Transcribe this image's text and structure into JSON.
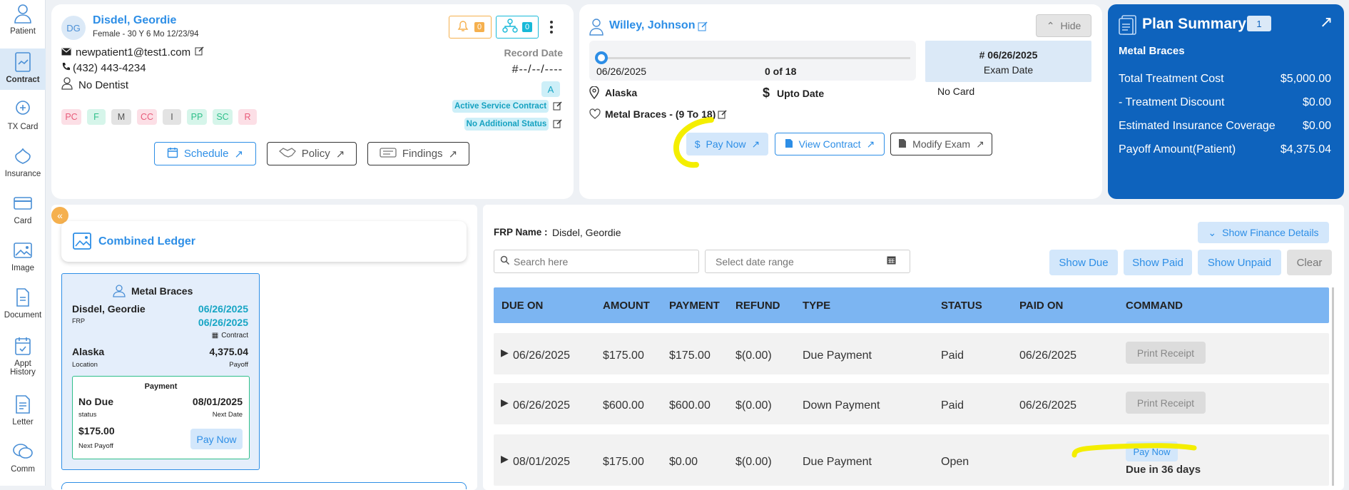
{
  "sidebar": {
    "items": [
      {
        "label": "Patient",
        "icon": "patient-icon"
      },
      {
        "label": "Contract",
        "icon": "contract-icon"
      },
      {
        "label": "TX Card",
        "icon": "tx-card-icon"
      },
      {
        "label": "Insurance",
        "icon": "insurance-icon"
      },
      {
        "label": "Card",
        "icon": "card-icon"
      },
      {
        "label": "Image",
        "icon": "image-icon"
      },
      {
        "label": "Document",
        "icon": "document-icon"
      },
      {
        "label": "Appt",
        "label2": "History",
        "icon": "appt-history-icon"
      },
      {
        "label": "Letter",
        "icon": "letter-icon"
      },
      {
        "label": "Comm",
        "icon": "comm-icon"
      }
    ]
  },
  "patient": {
    "initials": "DG",
    "name": "Disdel, Geordie",
    "details": "Female - 30 Y 6 Mo 12/23/94",
    "email": "newpatient1@test1.com",
    "phone": "(432) 443-4234",
    "dentist": "No Dentist",
    "alert_count": "0",
    "tree_count": "0",
    "record_date_label": "Record Date",
    "record_date_value": "#--/--/----",
    "badge_a": "A",
    "active_contract": "Active Service Contract",
    "no_additional_status": "No Additional Status",
    "tags": [
      "PC",
      "F",
      "M",
      "CC",
      "I",
      "PP",
      "SC",
      "R"
    ],
    "buttons": {
      "schedule": "Schedule",
      "policy": "Policy",
      "findings": "Findings"
    }
  },
  "doctor": {
    "name": "Willey, Johnson",
    "hide_label": "Hide",
    "progress_date": "06/26/2025",
    "progress_count": "0 of 18",
    "progress_fraction": 0,
    "exam_date_value": "# 06/26/2025",
    "exam_date_label": "Exam Date",
    "location": "Alaska",
    "upto_date": "Upto Date",
    "no_card": "No Card",
    "treatment": "Metal Braces - (9 To 18)",
    "buttons": {
      "pay_now": "Pay Now",
      "view_contract": "View Contract",
      "modify_exam": "Modify Exam"
    }
  },
  "plan_summary": {
    "title": "Plan Summary",
    "count": "1",
    "subtitle": "Metal Braces",
    "rows": [
      {
        "label": "Total Treatment Cost",
        "value": "$5,000.00"
      },
      {
        "label": "- Treatment Discount",
        "value": "$0.00"
      },
      {
        "label": "Estimated Insurance Coverage",
        "value": "$0.00"
      },
      {
        "label": "Payoff Amount(Patient)",
        "value": "$4,375.04"
      }
    ]
  },
  "ledger": {
    "title": "Combined Ledger",
    "contract_card": {
      "title": "Metal Braces",
      "name": "Disdel, Geordie",
      "name_sub": "FRP",
      "date1": "06/26/2025",
      "date2": "06/26/2025",
      "contract_label": "Contract",
      "location": "Alaska",
      "location_sub": "Location",
      "payoff_value": "4,375.04",
      "payoff_label": "Payoff",
      "payment": {
        "title": "Payment",
        "status": "No Due",
        "status_sub": "status",
        "next_date": "08/01/2025",
        "next_date_sub": "Next Date",
        "amount": "$175.00",
        "amount_sub": "Next Payoff",
        "pay_now": "Pay Now"
      }
    }
  },
  "finance": {
    "frp_label": "FRP Name :",
    "frp_name": "Disdel, Geordie",
    "show_finance_details": "Show Finance Details",
    "search_placeholder": "Search here",
    "date_placeholder": "Select date range",
    "filters": {
      "show_due": "Show Due",
      "show_paid": "Show Paid",
      "show_unpaid": "Show Unpaid",
      "clear": "Clear"
    },
    "columns": [
      "DUE ON",
      "AMOUNT",
      "PAYMENT",
      "REFUND",
      "TYPE",
      "STATUS",
      "PAID ON",
      "COMMAND"
    ],
    "rows": [
      {
        "due_on": "06/26/2025",
        "amount": "$175.00",
        "payment": "$175.00",
        "refund": "$(0.00)",
        "type": "Due Payment",
        "status": "Paid",
        "paid_on": "06/26/2025",
        "command": "Print Receipt"
      },
      {
        "due_on": "06/26/2025",
        "amount": "$600.00",
        "payment": "$600.00",
        "refund": "$(0.00)",
        "type": "Down Payment",
        "status": "Paid",
        "paid_on": "06/26/2025",
        "command": "Print Receipt"
      },
      {
        "due_on": "08/01/2025",
        "amount": "$175.00",
        "payment": "$0.00",
        "refund": "$(0.00)",
        "type": "Due Payment",
        "status": "Open",
        "paid_on": "",
        "command": "Pay Now",
        "command_note": "Due in 36 days"
      }
    ]
  },
  "colors": {
    "accent": "#2d8ee6",
    "plan_bg": "#0e63bd",
    "header_bg": "#7cb5f2",
    "highlight": "#f4ee00"
  }
}
